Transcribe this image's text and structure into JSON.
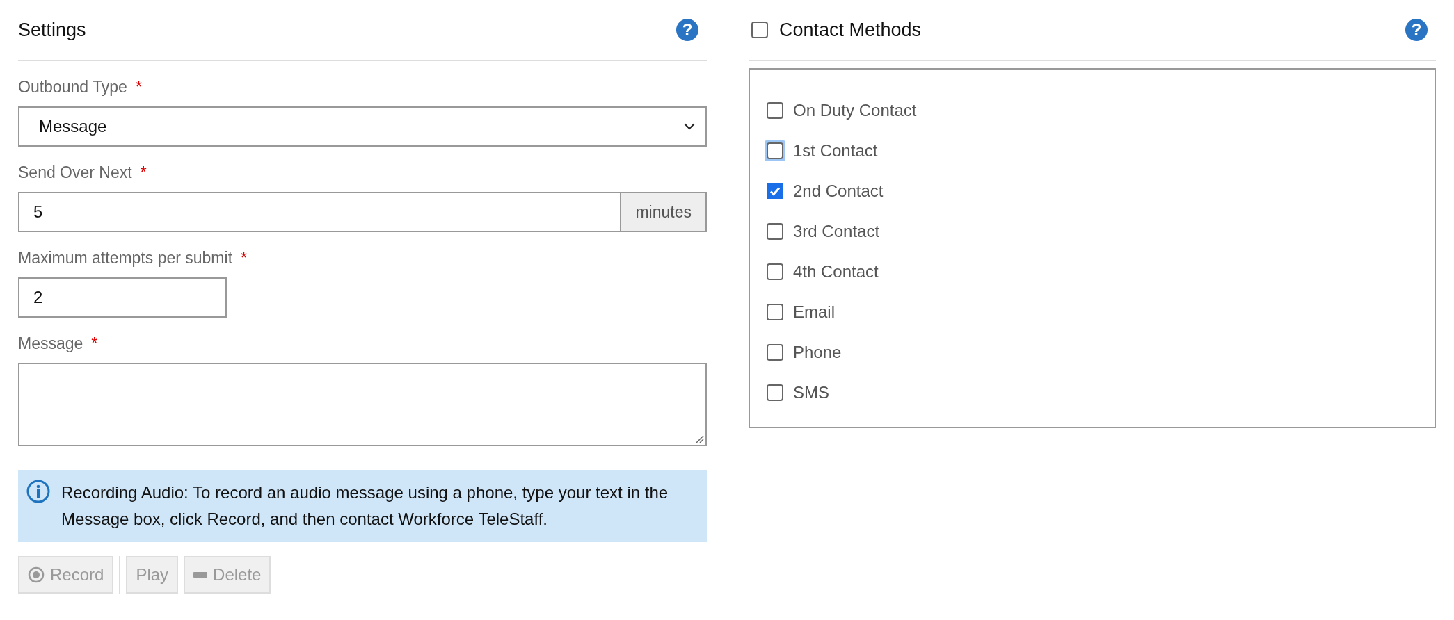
{
  "settings": {
    "title": "Settings",
    "help": "?",
    "fields": [
      {
        "kind": "select",
        "label": "Outbound Type",
        "required": true,
        "value": "Message"
      },
      {
        "kind": "addon",
        "label": "Send Over Next",
        "required": true,
        "value": "5",
        "addon": "minutes"
      },
      {
        "kind": "short",
        "label": "Maximum attempts per submit",
        "required": true,
        "value": "2"
      },
      {
        "kind": "textarea",
        "label": "Message",
        "required": true
      }
    ],
    "required_mark": "*",
    "info": "Recording Audio: To record an audio message using a phone, type your text in the Message box, click Record, and then contact Workforce TeleStaff.",
    "buttons": [
      {
        "kind": "record",
        "label": "Record",
        "disabled": true
      },
      {
        "kind": "play",
        "label": "Play",
        "disabled": true
      },
      {
        "kind": "delete",
        "label": "Delete",
        "disabled": true
      }
    ]
  },
  "contact_methods": {
    "title": "Contact Methods",
    "help": "?",
    "checked": false,
    "items": [
      {
        "label": "On Duty Contact",
        "checked": false,
        "focused": false
      },
      {
        "label": "1st Contact",
        "checked": false,
        "focused": true
      },
      {
        "label": "2nd Contact",
        "checked": true,
        "focused": false
      },
      {
        "label": "3rd Contact",
        "checked": false,
        "focused": false
      },
      {
        "label": "4th Contact",
        "checked": false,
        "focused": false
      },
      {
        "label": "Email",
        "checked": false,
        "focused": false
      },
      {
        "label": "Phone",
        "checked": false,
        "focused": false
      },
      {
        "label": "SMS",
        "checked": false,
        "focused": false
      }
    ]
  }
}
